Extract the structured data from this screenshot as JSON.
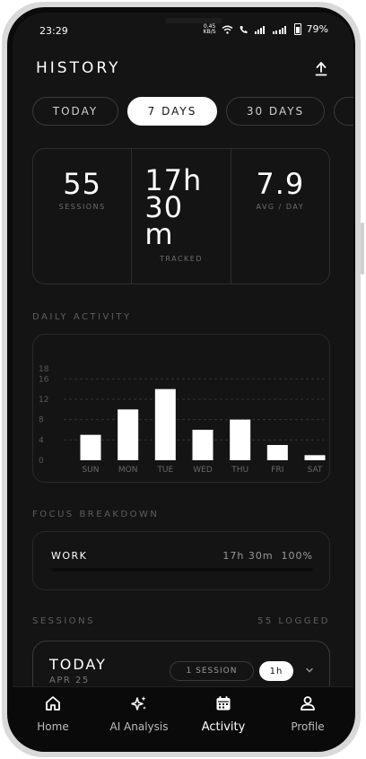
{
  "status_bar": {
    "time": "23:29",
    "data_rate_value": "0.45",
    "data_rate_unit": "KB/S",
    "battery": "79%"
  },
  "header": {
    "title": "HISTORY",
    "export_icon": "upload-icon"
  },
  "tabs": [
    {
      "label": "TODAY",
      "active": false
    },
    {
      "label": "7 DAYS",
      "active": true
    },
    {
      "label": "30 DAYS",
      "active": false
    }
  ],
  "stats": {
    "sessions": {
      "value": "55",
      "label": "SESSIONS"
    },
    "tracked": {
      "value": "17h 30 m",
      "label": "TRACKED"
    },
    "avg": {
      "value": "7.9",
      "label": "AVG / DAY"
    }
  },
  "daily_activity": {
    "section_label": "DAILY ACTIVITY"
  },
  "chart_data": {
    "type": "bar",
    "categories": [
      "SUN",
      "MON",
      "TUE",
      "WED",
      "THU",
      "FRI",
      "SAT"
    ],
    "values": [
      5,
      10,
      14,
      6,
      8,
      3,
      1
    ],
    "yticks": [
      "0",
      "4",
      "8",
      "12",
      "16",
      "18"
    ],
    "ylim": [
      0,
      18
    ],
    "grid": true,
    "bar_color": "#ffffff"
  },
  "focus": {
    "section_label": "FOCUS BREAKDOWN",
    "items": [
      {
        "name": "WORK",
        "duration": "17h 30m",
        "percent_label": "100%",
        "fraction": 1.0
      }
    ]
  },
  "sessions": {
    "section_label": "SESSIONS",
    "count_label": "55 LOGGED",
    "groups": [
      {
        "title": "TODAY",
        "date": "APR 25",
        "session_count": "1 SESSION",
        "duration": "1h"
      }
    ]
  },
  "nav": {
    "items": [
      {
        "label": "Home",
        "icon": "home-icon",
        "active": false
      },
      {
        "label": "AI Analysis",
        "icon": "sparkles-icon",
        "active": false
      },
      {
        "label": "Activity",
        "icon": "calendar-icon",
        "active": true
      },
      {
        "label": "Profile",
        "icon": "user-icon",
        "active": false
      }
    ]
  }
}
